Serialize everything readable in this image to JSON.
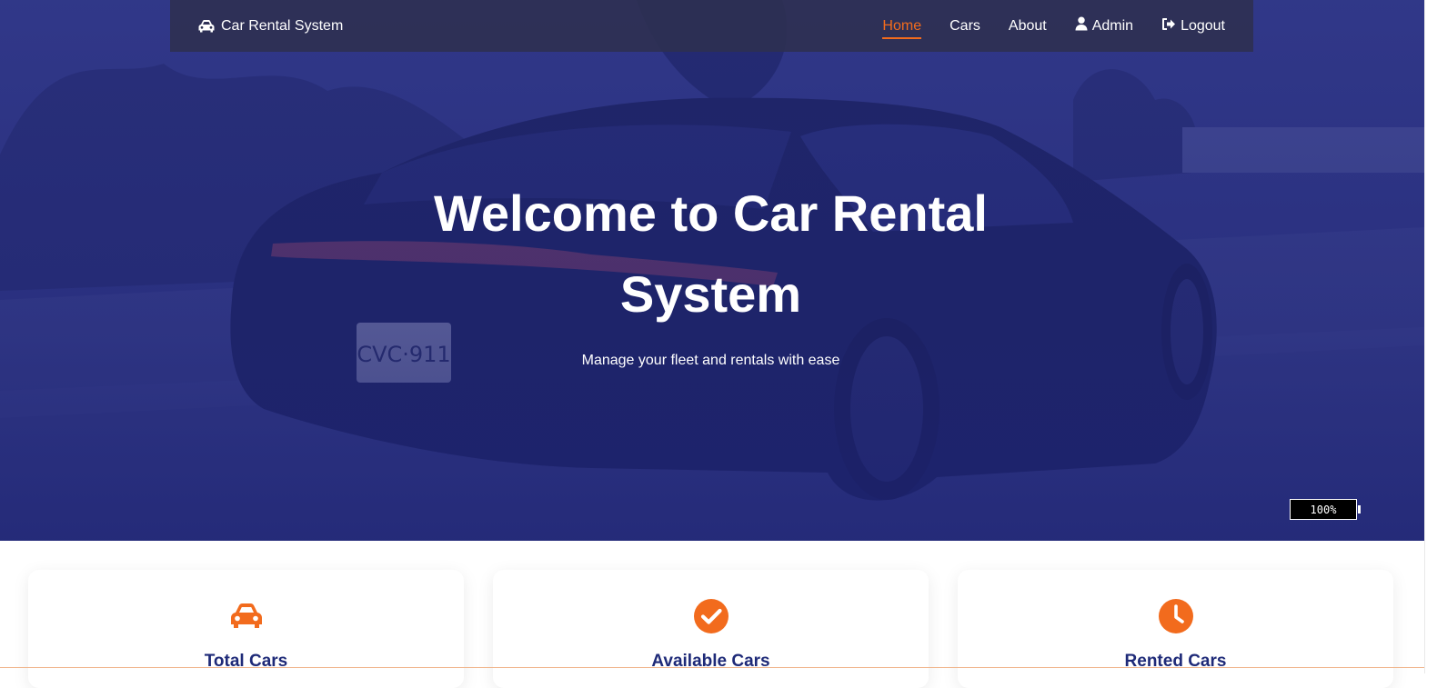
{
  "colors": {
    "accent": "#f26b1d",
    "hero_tint": "#232a78",
    "card_title": "#1e2a78"
  },
  "navbar": {
    "brand_icon": "car-icon",
    "brand_label": "Car Rental System",
    "links": [
      {
        "label": "Home",
        "active": true
      },
      {
        "label": "Cars"
      },
      {
        "label": "About"
      },
      {
        "label": "Admin",
        "icon": "user-icon"
      },
      {
        "label": "Logout",
        "icon": "logout-icon"
      }
    ]
  },
  "hero": {
    "title_line1": "Welcome to Car Rental",
    "title_line2": "System",
    "subtitle": "Manage your fleet and rentals with ease"
  },
  "battery": {
    "label": "100%"
  },
  "stats": [
    {
      "label": "Total Cars",
      "icon": "car-icon"
    },
    {
      "label": "Available Cars",
      "icon": "check-circle-icon"
    },
    {
      "label": "Rented Cars",
      "icon": "clock-icon"
    }
  ]
}
